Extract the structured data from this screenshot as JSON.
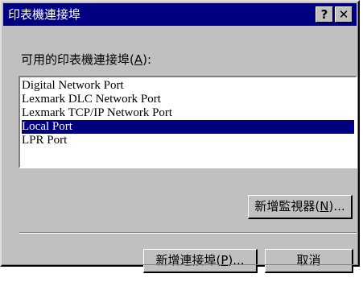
{
  "window": {
    "title": "印表機連接埠",
    "help_label": "?",
    "close_label": "✕"
  },
  "ports_label": {
    "text": "可用的印表機連接埠(",
    "mnemonic": "A",
    "suffix": "):"
  },
  "ports": [
    {
      "label": "Digital Network Port",
      "selected": false
    },
    {
      "label": "Lexmark DLC Network Port",
      "selected": false
    },
    {
      "label": "Lexmark TCP/IP Network Port",
      "selected": false
    },
    {
      "label": "Local Port",
      "selected": true
    },
    {
      "label": "LPR Port",
      "selected": false
    }
  ],
  "buttons": {
    "add_monitor": {
      "text": "新增監視器(",
      "mnemonic": "N",
      "suffix": ")..."
    },
    "add_port": {
      "text": "新增連接埠(",
      "mnemonic": "P",
      "suffix": ")..."
    },
    "cancel": "取消"
  },
  "colors": {
    "titlebar": "#000080",
    "dialog_face": "#c0c0c0",
    "selection": "#000080"
  }
}
